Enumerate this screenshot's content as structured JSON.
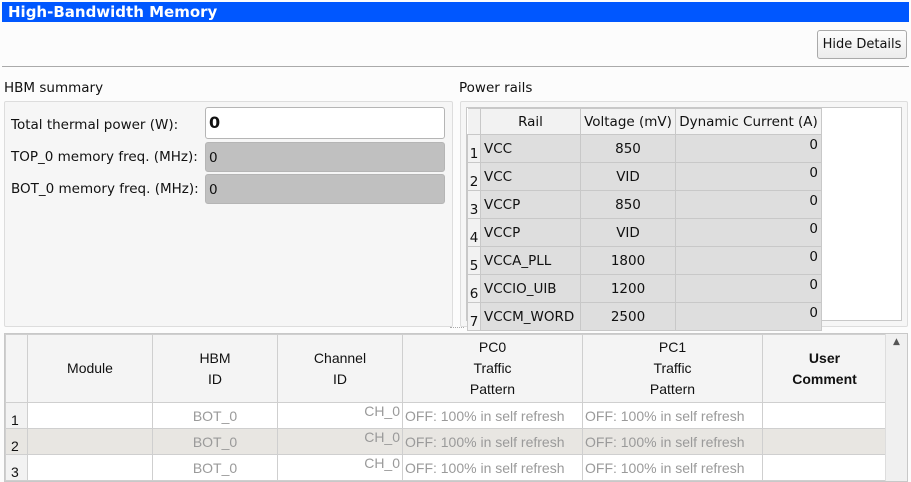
{
  "window": {
    "title": "High-Bandwidth Memory"
  },
  "toolbar": {
    "hide_details": "Hide Details"
  },
  "summary": {
    "title": "HBM summary",
    "fields": [
      {
        "label": "Total thermal power (W):",
        "value": "0"
      },
      {
        "label": "TOP_0 memory freq. (MHz):",
        "value": "0"
      },
      {
        "label": "BOT_0 memory freq. (MHz):",
        "value": "0"
      }
    ]
  },
  "rails": {
    "title": "Power rails",
    "headers": [
      "Rail",
      "Voltage (mV)",
      "Dynamic Current (A)"
    ],
    "rows": [
      {
        "n": "1",
        "rail": "VCC",
        "voltage": "850",
        "current": "0"
      },
      {
        "n": "2",
        "rail": "VCC",
        "voltage": "VID",
        "current": "0"
      },
      {
        "n": "3",
        "rail": "VCCP",
        "voltage": "850",
        "current": "0"
      },
      {
        "n": "4",
        "rail": "VCCP",
        "voltage": "VID",
        "current": "0"
      },
      {
        "n": "5",
        "rail": "VCCA_PLL",
        "voltage": "1800",
        "current": "0"
      },
      {
        "n": "6",
        "rail": "VCCIO_UIB",
        "voltage": "1200",
        "current": "0"
      },
      {
        "n": "7",
        "rail": "VCCM_WORD",
        "voltage": "2500",
        "current": "0"
      }
    ]
  },
  "modules": {
    "headers": [
      [
        "Module"
      ],
      [
        "HBM",
        "ID"
      ],
      [
        "Channel",
        "ID"
      ],
      [
        "PC0",
        "Traffic",
        "Pattern"
      ],
      [
        "PC1",
        "Traffic",
        "Pattern"
      ],
      [
        "User",
        "Comment"
      ]
    ],
    "rows": [
      {
        "n": "1",
        "module": "",
        "hbm": "BOT_0",
        "channel": "CH_0",
        "pc0": "OFF: 100% in self refresh",
        "pc1": "OFF: 100% in self refresh",
        "comment": ""
      },
      {
        "n": "2",
        "module": "",
        "hbm": "BOT_0",
        "channel": "CH_0",
        "pc0": "OFF: 100% in self refresh",
        "pc1": "OFF: 100% in self refresh",
        "comment": ""
      },
      {
        "n": "3",
        "module": "",
        "hbm": "BOT_0",
        "channel": "CH_0",
        "pc0": "OFF: 100% in self refresh",
        "pc1": "OFF: 100% in self refresh",
        "comment": ""
      }
    ]
  }
}
